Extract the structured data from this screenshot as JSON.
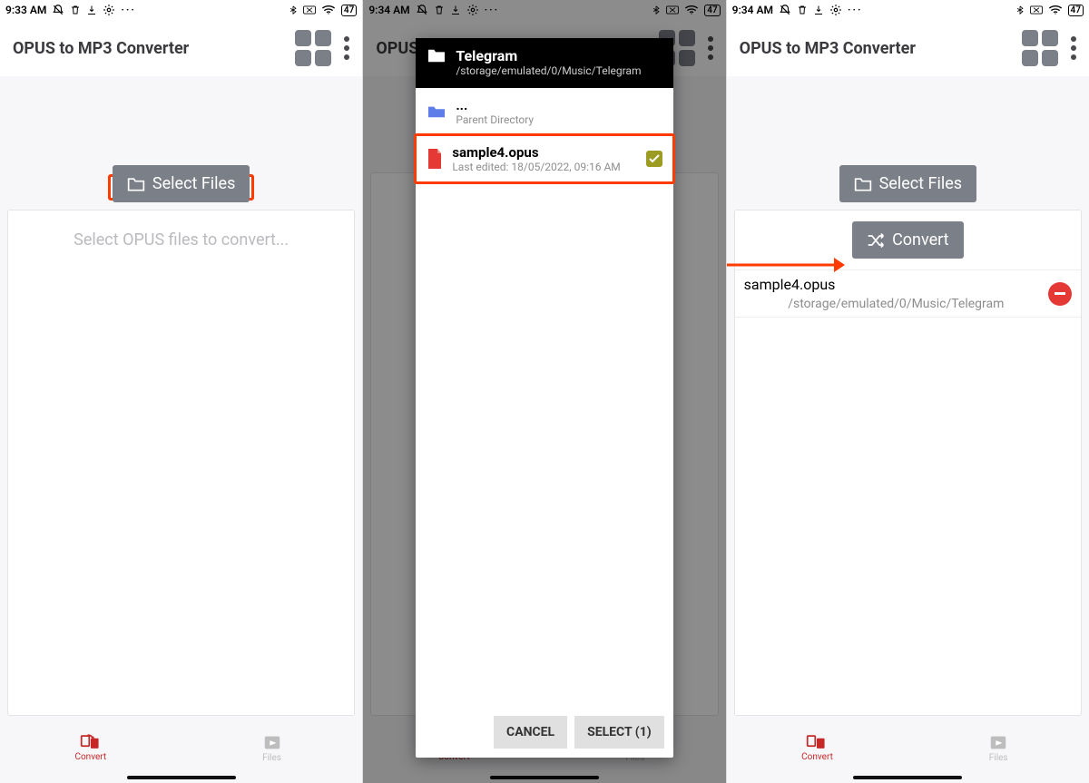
{
  "s1": {
    "time": "9:33 AM",
    "battery": "47",
    "title": "OPUS to MP3 Converter",
    "select_btn": "Select Files",
    "empty": "Select OPUS files to convert...",
    "nav": {
      "convert": "Convert",
      "files": "Files"
    }
  },
  "s2": {
    "time": "9:34 AM",
    "battery": "47",
    "title": "OPUS",
    "dlg": {
      "title": "Telegram",
      "path": "/storage/emulated/0/Music/Telegram",
      "parent_dots": "...",
      "parent": "Parent Directory",
      "file": "sample4.opus",
      "edited": "Last edited: 18/05/2022, 09:16 AM",
      "cancel": "CANCEL",
      "select": "SELECT (1)"
    },
    "nav": {
      "convert": "Convert",
      "files": "Files"
    }
  },
  "s3": {
    "time": "9:34 AM",
    "battery": "47",
    "title": "OPUS to MP3 Converter",
    "select_btn": "Select Files",
    "convert_btn": "Convert",
    "file": {
      "name": "sample4.opus",
      "path": "/storage/emulated/0/Music/Telegram"
    },
    "nav": {
      "convert": "Convert",
      "files": "Files"
    }
  }
}
